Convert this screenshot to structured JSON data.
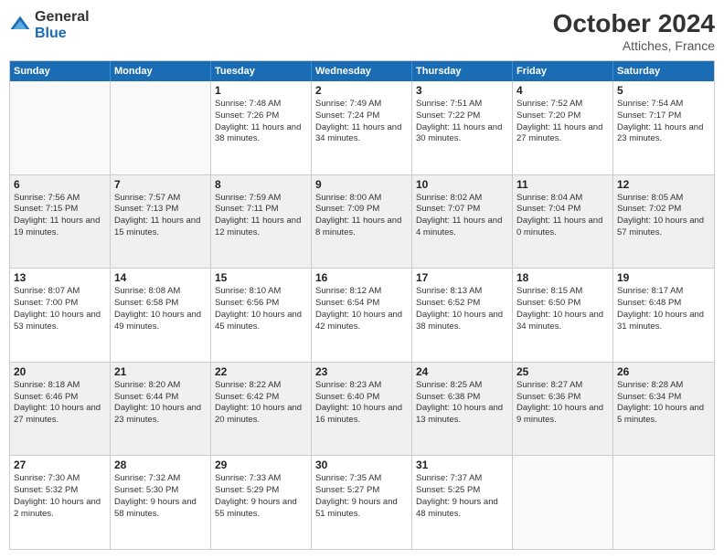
{
  "header": {
    "logo_general": "General",
    "logo_blue": "Blue",
    "title": "October 2024",
    "subtitle": "Attiches, France"
  },
  "weekdays": [
    "Sunday",
    "Monday",
    "Tuesday",
    "Wednesday",
    "Thursday",
    "Friday",
    "Saturday"
  ],
  "rows": [
    [
      {
        "day": "",
        "info": "",
        "empty": true
      },
      {
        "day": "",
        "info": "",
        "empty": true
      },
      {
        "day": "1",
        "info": "Sunrise: 7:48 AM\nSunset: 7:26 PM\nDaylight: 11 hours and 38 minutes."
      },
      {
        "day": "2",
        "info": "Sunrise: 7:49 AM\nSunset: 7:24 PM\nDaylight: 11 hours and 34 minutes."
      },
      {
        "day": "3",
        "info": "Sunrise: 7:51 AM\nSunset: 7:22 PM\nDaylight: 11 hours and 30 minutes."
      },
      {
        "day": "4",
        "info": "Sunrise: 7:52 AM\nSunset: 7:20 PM\nDaylight: 11 hours and 27 minutes."
      },
      {
        "day": "5",
        "info": "Sunrise: 7:54 AM\nSunset: 7:17 PM\nDaylight: 11 hours and 23 minutes."
      }
    ],
    [
      {
        "day": "6",
        "info": "Sunrise: 7:56 AM\nSunset: 7:15 PM\nDaylight: 11 hours and 19 minutes."
      },
      {
        "day": "7",
        "info": "Sunrise: 7:57 AM\nSunset: 7:13 PM\nDaylight: 11 hours and 15 minutes."
      },
      {
        "day": "8",
        "info": "Sunrise: 7:59 AM\nSunset: 7:11 PM\nDaylight: 11 hours and 12 minutes."
      },
      {
        "day": "9",
        "info": "Sunrise: 8:00 AM\nSunset: 7:09 PM\nDaylight: 11 hours and 8 minutes."
      },
      {
        "day": "10",
        "info": "Sunrise: 8:02 AM\nSunset: 7:07 PM\nDaylight: 11 hours and 4 minutes."
      },
      {
        "day": "11",
        "info": "Sunrise: 8:04 AM\nSunset: 7:04 PM\nDaylight: 11 hours and 0 minutes."
      },
      {
        "day": "12",
        "info": "Sunrise: 8:05 AM\nSunset: 7:02 PM\nDaylight: 10 hours and 57 minutes."
      }
    ],
    [
      {
        "day": "13",
        "info": "Sunrise: 8:07 AM\nSunset: 7:00 PM\nDaylight: 10 hours and 53 minutes."
      },
      {
        "day": "14",
        "info": "Sunrise: 8:08 AM\nSunset: 6:58 PM\nDaylight: 10 hours and 49 minutes."
      },
      {
        "day": "15",
        "info": "Sunrise: 8:10 AM\nSunset: 6:56 PM\nDaylight: 10 hours and 45 minutes."
      },
      {
        "day": "16",
        "info": "Sunrise: 8:12 AM\nSunset: 6:54 PM\nDaylight: 10 hours and 42 minutes."
      },
      {
        "day": "17",
        "info": "Sunrise: 8:13 AM\nSunset: 6:52 PM\nDaylight: 10 hours and 38 minutes."
      },
      {
        "day": "18",
        "info": "Sunrise: 8:15 AM\nSunset: 6:50 PM\nDaylight: 10 hours and 34 minutes."
      },
      {
        "day": "19",
        "info": "Sunrise: 8:17 AM\nSunset: 6:48 PM\nDaylight: 10 hours and 31 minutes."
      }
    ],
    [
      {
        "day": "20",
        "info": "Sunrise: 8:18 AM\nSunset: 6:46 PM\nDaylight: 10 hours and 27 minutes."
      },
      {
        "day": "21",
        "info": "Sunrise: 8:20 AM\nSunset: 6:44 PM\nDaylight: 10 hours and 23 minutes."
      },
      {
        "day": "22",
        "info": "Sunrise: 8:22 AM\nSunset: 6:42 PM\nDaylight: 10 hours and 20 minutes."
      },
      {
        "day": "23",
        "info": "Sunrise: 8:23 AM\nSunset: 6:40 PM\nDaylight: 10 hours and 16 minutes."
      },
      {
        "day": "24",
        "info": "Sunrise: 8:25 AM\nSunset: 6:38 PM\nDaylight: 10 hours and 13 minutes."
      },
      {
        "day": "25",
        "info": "Sunrise: 8:27 AM\nSunset: 6:36 PM\nDaylight: 10 hours and 9 minutes."
      },
      {
        "day": "26",
        "info": "Sunrise: 8:28 AM\nSunset: 6:34 PM\nDaylight: 10 hours and 5 minutes."
      }
    ],
    [
      {
        "day": "27",
        "info": "Sunrise: 7:30 AM\nSunset: 5:32 PM\nDaylight: 10 hours and 2 minutes."
      },
      {
        "day": "28",
        "info": "Sunrise: 7:32 AM\nSunset: 5:30 PM\nDaylight: 9 hours and 58 minutes."
      },
      {
        "day": "29",
        "info": "Sunrise: 7:33 AM\nSunset: 5:29 PM\nDaylight: 9 hours and 55 minutes."
      },
      {
        "day": "30",
        "info": "Sunrise: 7:35 AM\nSunset: 5:27 PM\nDaylight: 9 hours and 51 minutes."
      },
      {
        "day": "31",
        "info": "Sunrise: 7:37 AM\nSunset: 5:25 PM\nDaylight: 9 hours and 48 minutes."
      },
      {
        "day": "",
        "info": "",
        "empty": true
      },
      {
        "day": "",
        "info": "",
        "empty": true
      }
    ]
  ]
}
